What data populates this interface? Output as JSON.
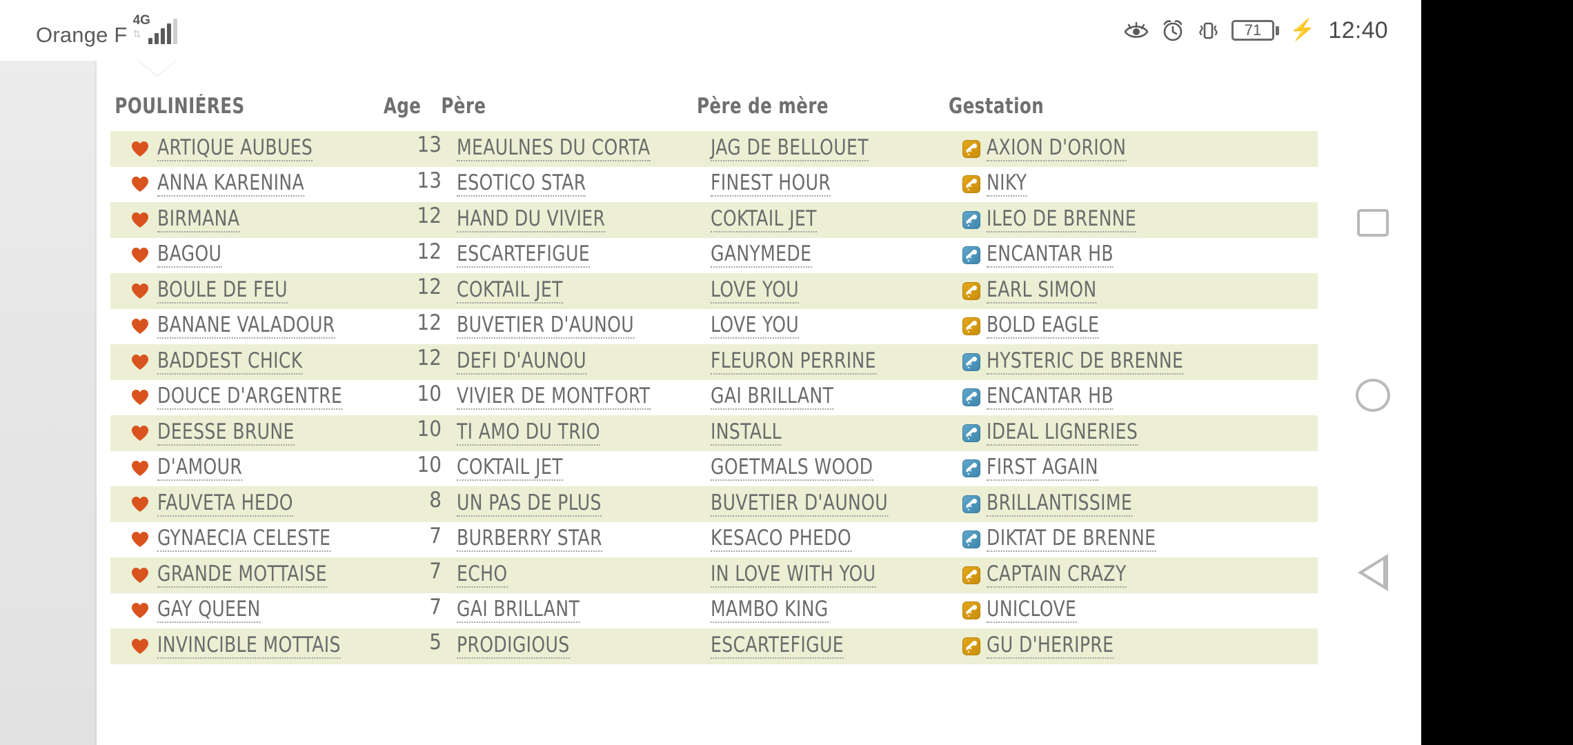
{
  "status_bar": {
    "carrier": "Orange F",
    "network_type": "4G",
    "signal_icon": "signal-bars-icon",
    "data_arrows_icon": "data-transfer-icon",
    "eye_comfort_icon": "eye-comfort-icon",
    "alarm_icon": "alarm-clock-icon",
    "vibrate_icon": "vibrate-mode-icon",
    "battery_level": "71",
    "charging_icon": "charging-bolt-icon",
    "time": "12:40"
  },
  "nav_bar": {
    "recents_label": "recents-icon",
    "home_label": "home-icon",
    "back_label": "back-icon"
  },
  "table": {
    "headers": {
      "name": "POULINIÉRES",
      "age": "Age",
      "pere": "Père",
      "pere_de_mere": "Père de mère",
      "gestation": "Gestation"
    },
    "rows": [
      {
        "fav_icon": "heart-icon",
        "name": "ARTIQUE AUBUES",
        "age": "13",
        "pere": "MEAULNES DU CORTA",
        "pere_de_mere": "JAG DE BELLOUET",
        "gestation": "AXION D'ORION",
        "gestation_icon_color": "gold"
      },
      {
        "fav_icon": "heart-icon",
        "name": "ANNA KARENINA",
        "age": "13",
        "pere": "ESOTICO STAR",
        "pere_de_mere": "FINEST HOUR",
        "gestation": "NIKY",
        "gestation_icon_color": "gold"
      },
      {
        "fav_icon": "heart-icon",
        "name": "BIRMANA",
        "age": "12",
        "pere": "HAND DU VIVIER",
        "pere_de_mere": "COKTAIL JET",
        "gestation": "ILEO DE BRENNE",
        "gestation_icon_color": "blue"
      },
      {
        "fav_icon": "heart-icon",
        "name": "BAGOU",
        "age": "12",
        "pere": "ESCARTEFIGUE",
        "pere_de_mere": "GANYMEDE",
        "gestation": "ENCANTAR HB",
        "gestation_icon_color": "blue"
      },
      {
        "fav_icon": "heart-icon",
        "name": "BOULE DE FEU",
        "age": "12",
        "pere": "COKTAIL JET",
        "pere_de_mere": "LOVE YOU",
        "gestation": "EARL SIMON",
        "gestation_icon_color": "gold"
      },
      {
        "fav_icon": "heart-icon",
        "name": "BANANE VALADOUR",
        "age": "12",
        "pere": "BUVETIER D'AUNOU",
        "pere_de_mere": "LOVE YOU",
        "gestation": "BOLD EAGLE",
        "gestation_icon_color": "gold"
      },
      {
        "fav_icon": "heart-icon",
        "name": "BADDEST CHICK",
        "age": "12",
        "pere": "DEFI D'AUNOU",
        "pere_de_mere": "FLEURON PERRINE",
        "gestation": "HYSTERIC DE BRENNE",
        "gestation_icon_color": "blue"
      },
      {
        "fav_icon": "heart-icon",
        "name": "DOUCE D'ARGENTRE",
        "age": "10",
        "pere": "VIVIER DE MONTFORT",
        "pere_de_mere": "GAI BRILLANT",
        "gestation": "ENCANTAR HB",
        "gestation_icon_color": "blue"
      },
      {
        "fav_icon": "heart-icon",
        "name": "DEESSE BRUNE",
        "age": "10",
        "pere": "TI AMO DU TRIO",
        "pere_de_mere": "INSTALL",
        "gestation": "IDEAL LIGNERIES",
        "gestation_icon_color": "blue"
      },
      {
        "fav_icon": "heart-icon",
        "name": "D'AMOUR",
        "age": "10",
        "pere": "COKTAIL JET",
        "pere_de_mere": "GOETMALS WOOD",
        "gestation": "FIRST AGAIN",
        "gestation_icon_color": "blue"
      },
      {
        "fav_icon": "heart-icon",
        "name": "FAUVETA HEDO",
        "age": "8",
        "pere": "UN PAS DE PLUS",
        "pere_de_mere": "BUVETIER D'AUNOU",
        "gestation": "BRILLANTISSIME",
        "gestation_icon_color": "blue"
      },
      {
        "fav_icon": "heart-icon",
        "name": "GYNAECIA CELESTE",
        "age": "7",
        "pere": "BURBERRY STAR",
        "pere_de_mere": "KESACO PHEDO",
        "gestation": "DIKTAT DE BRENNE",
        "gestation_icon_color": "blue"
      },
      {
        "fav_icon": "heart-icon",
        "name": "GRANDE MOTTAISE",
        "age": "7",
        "pere": "ECHO",
        "pere_de_mere": "IN LOVE WITH YOU",
        "gestation": "CAPTAIN CRAZY",
        "gestation_icon_color": "gold"
      },
      {
        "fav_icon": "heart-icon",
        "name": "GAY QUEEN",
        "age": "7",
        "pere": "GAI BRILLANT",
        "pere_de_mere": "MAMBO KING",
        "gestation": "UNICLOVE",
        "gestation_icon_color": "gold"
      },
      {
        "fav_icon": "heart-icon",
        "name": "INVINCIBLE MOTTAIS",
        "age": "5",
        "pere": "PRODIGIOUS",
        "pere_de_mere": "ESCARTEFIGUE",
        "gestation": "GU D'HERIPRE",
        "gestation_icon_color": "gold"
      }
    ]
  },
  "colors": {
    "row_highlight": "#ecefd4",
    "heart": "#d9531e",
    "text": "#6b6b6b",
    "header_text": "#6f6f6f",
    "gestation_gold": "#d89b12",
    "gestation_blue": "#4f97bd"
  }
}
